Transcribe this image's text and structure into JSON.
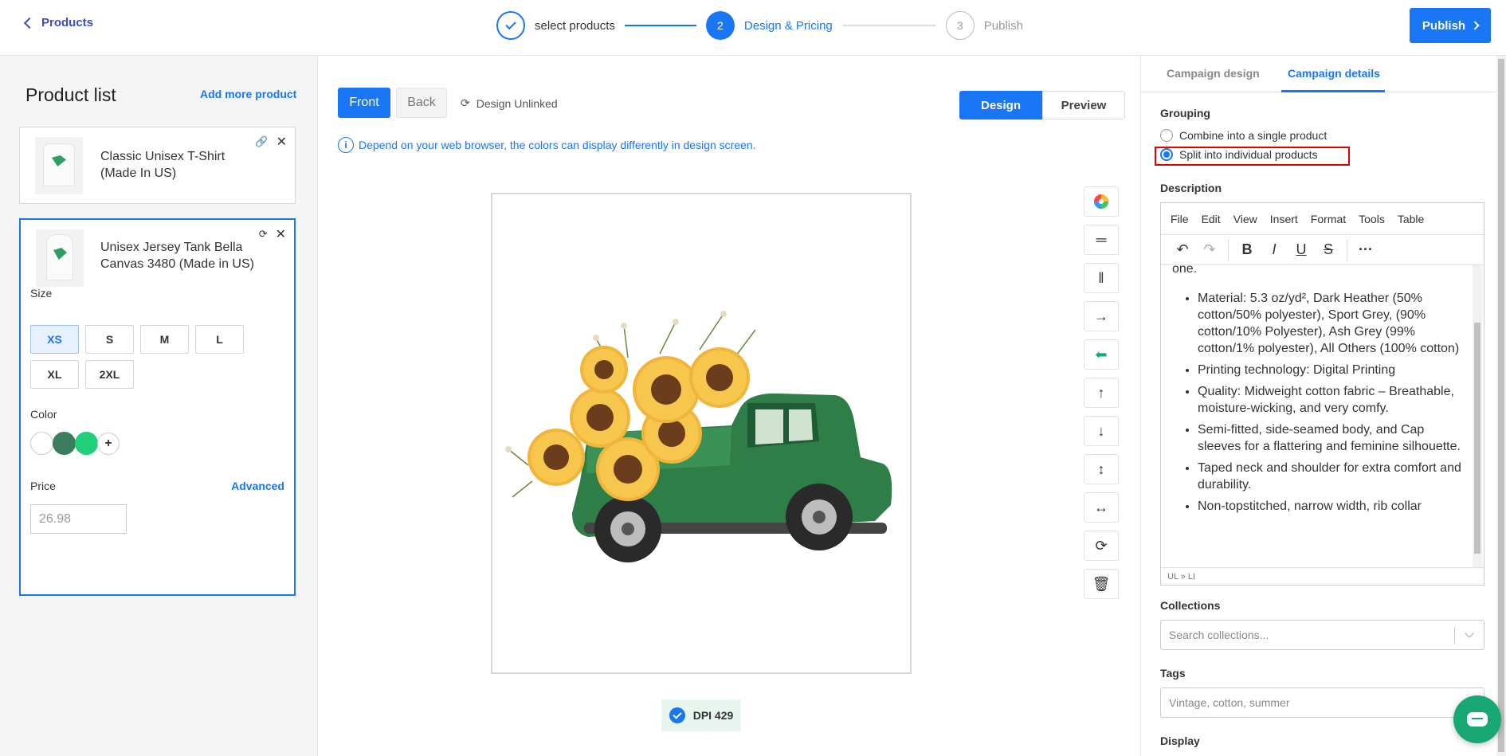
{
  "header": {
    "back_label": "Products",
    "steps": [
      {
        "label": "select products",
        "number": ""
      },
      {
        "label": "Design & Pricing",
        "number": "2"
      },
      {
        "label": "Publish",
        "number": "3"
      }
    ],
    "publish_label": "Publish"
  },
  "left": {
    "title": "Product list",
    "add_more": "Add more product",
    "products": [
      {
        "name": "Classic Unisex T-Shirt (Made In US)"
      },
      {
        "name": "Unisex Jersey Tank Bella Canvas 3480 (Made in US)"
      }
    ],
    "size_label": "Size",
    "sizes": [
      "XS",
      "S",
      "M",
      "L",
      "XL",
      "2XL"
    ],
    "selected_size": "XS",
    "color_label": "Color",
    "colors": [
      "#ffffff",
      "#3d7d5f",
      "#1fcf7a"
    ],
    "color_add": "+",
    "price_label": "Price",
    "advanced_label": "Advanced",
    "price_value": "26.98"
  },
  "center": {
    "front_label": "Front",
    "back_label": "Back",
    "unlinked_label": "Design Unlinked",
    "design_label": "Design",
    "preview_label": "Preview",
    "notice": "Depend on your web browser, the colors can display differently in design screen.",
    "dpi_label": "DPI 429"
  },
  "right": {
    "tab_design": "Campaign design",
    "tab_details": "Campaign details",
    "grouping_label": "Grouping",
    "option_combine": "Combine into a single product",
    "option_split": "Split into individual products",
    "description_label": "Description",
    "menu": [
      "File",
      "Edit",
      "View",
      "Insert",
      "Format",
      "Tools",
      "Table"
    ],
    "editor_intro": "one.",
    "editor_items": [
      "Material: 5.3 oz/yd², Dark Heather (50% cotton/50% polyester), Sport Grey, (90% cotton/10% Polyester), Ash Grey (99% cotton/1% polyester), All Others (100% cotton)",
      "Printing technology: Digital Printing",
      "Quality: Midweight cotton fabric – Breathable, moisture-wicking, and very comfy.",
      "Semi-fitted, side-seamed body, and Cap sleeves for a flattering and feminine silhouette.",
      "Taped neck and shoulder for extra comfort and durability.",
      "Non-topstitched, narrow width, rib collar"
    ],
    "editor_status": "UL » LI",
    "collections_label": "Collections",
    "collections_placeholder": "Search collections...",
    "tags_label": "Tags",
    "tags_value": "Vintage, cotton, summer",
    "display_label": "Display"
  }
}
